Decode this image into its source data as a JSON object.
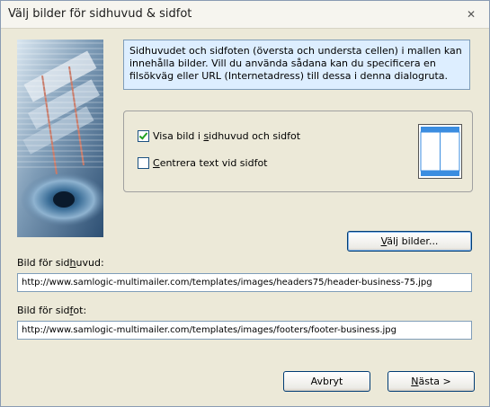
{
  "window": {
    "title": "Välj bilder för sidhuvud & sidfot",
    "close_glyph": "✕"
  },
  "info_text": "Sidhuvudet och sidfoten (översta och understa cellen) i mallen kan innehålla bilder. Vill du använda sådana kan du specificera en filsökväg eller URL (Internetadress) till dessa i denna dialogruta.",
  "options": {
    "show_image": {
      "label_pre": "Visa bild i ",
      "label_u": "s",
      "label_post": "idhuvud och sidfot",
      "checked": true
    },
    "center_text": {
      "label_pre": "",
      "label_u": "C",
      "label_post": "entrera text vid sidfot",
      "checked": false
    }
  },
  "choose_images": {
    "label_pre": "",
    "label_u": "V",
    "label_post": "älj bilder..."
  },
  "header_image": {
    "label_pre": "Bild för sid",
    "label_u": "h",
    "label_post": "uvud:",
    "value": "http://www.samlogic-multimailer.com/templates/images/headers75/header-business-75.jpg"
  },
  "footer_image": {
    "label_pre": "Bild för sid",
    "label_u": "f",
    "label_post": "ot:",
    "value": "http://www.samlogic-multimailer.com/templates/images/footers/footer-business.jpg"
  },
  "buttons": {
    "cancel": "Avbryt",
    "next_pre": "",
    "next_u": "N",
    "next_post": "ästa >"
  },
  "colors": {
    "dialog_bg": "#ece9d8",
    "info_bg": "#ddeeff",
    "preview_accent": "#3b8de0"
  },
  "icons": {
    "banner": "decorative-photo-banner",
    "preview": "page-layout-preview-icon",
    "close": "close-icon",
    "checkmark": "checkmark-icon"
  }
}
